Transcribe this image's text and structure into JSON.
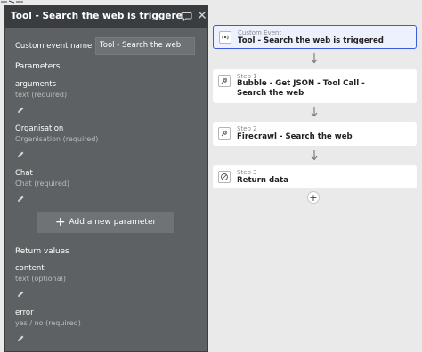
{
  "panel": {
    "title": "Tool - Search the web is triggere",
    "event_name_label": "Custom event name",
    "event_name_value": "Tool - Search the web",
    "parameters_heading": "Parameters",
    "parameters": [
      {
        "name": "arguments",
        "type": "text (required)"
      },
      {
        "name": "Organisation",
        "type": "Organisation (required)"
      },
      {
        "name": "Chat",
        "type": "Chat (required)"
      }
    ],
    "add_parameter_label": "Add a new parameter",
    "return_values_heading": "Return values",
    "return_values": [
      {
        "name": "content",
        "type": "text (optional)"
      },
      {
        "name": "error",
        "type": "yes / no (required)"
      }
    ]
  },
  "workflow": {
    "event": {
      "kind": "Custom Event",
      "title": "Tool - Search the web is triggered"
    },
    "steps": [
      {
        "kind": "Step 1",
        "title": "Bubble - Get JSON - Tool Call - Search the web"
      },
      {
        "kind": "Step 2",
        "title": "Firecrawl - Search the web"
      },
      {
        "kind": "Step 3",
        "title": "Return data"
      }
    ]
  },
  "icons": {
    "event": "broadcast-icon",
    "step1": "plugin-icon",
    "step2": "plugin-icon",
    "step3": "return-icon",
    "close": "close-icon",
    "comment": "comment-icon",
    "edit": "pencil-icon"
  },
  "colors": {
    "selected_border": "#3b5bdb",
    "panel_bg": "#5d6163",
    "header_bg": "#3a3d40"
  }
}
